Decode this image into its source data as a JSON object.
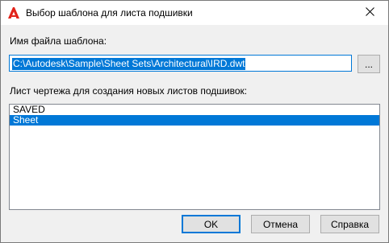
{
  "window": {
    "title": "Выбор шаблона для листа подшивки",
    "icon": "autocad-icon",
    "close_icon": "close-icon"
  },
  "template": {
    "label": "Имя файла шаблона:",
    "value": "C:\\Autodesk\\Sample\\Sheet Sets\\Architectural\\IRD.dwt",
    "browse_label": "..."
  },
  "layouts": {
    "label": "Лист чертежа для создания новых листов подшивок:",
    "items": [
      {
        "label": "SAVED",
        "selected": false
      },
      {
        "label": "Sheet",
        "selected": true
      }
    ]
  },
  "buttons": {
    "ok": "OK",
    "cancel": "Отмена",
    "help": "Справка"
  },
  "colors": {
    "accent": "#0078d7",
    "brand": "#e2231a"
  }
}
